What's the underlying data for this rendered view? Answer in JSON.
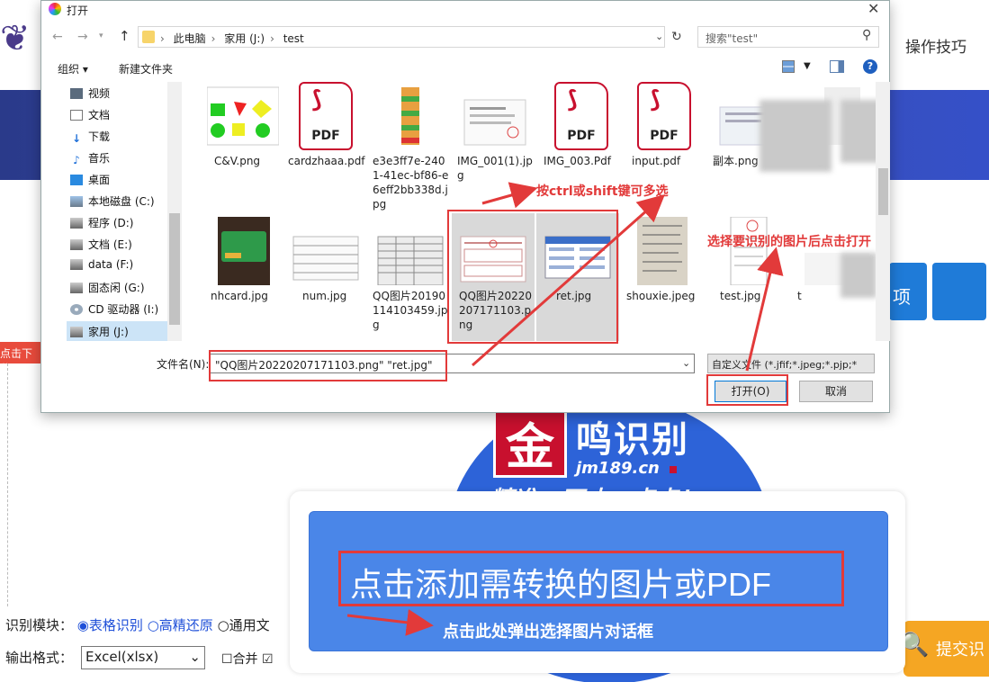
{
  "background": {
    "nav_item": "操作技巧",
    "download_tag": "点击下载",
    "options_label": "识别模块：",
    "options": [
      "表格识别",
      "高精还原",
      "通用文"
    ],
    "format_label": "输出格式：",
    "format_value": "Excel(xlsx)",
    "merge_label": "合并",
    "submit_label": "提交识",
    "tile_text": "项"
  },
  "logo": {
    "mark": "金",
    "name": "鸣识别",
    "url": "jm189.cn",
    "slogan": "精准，不止一点点！"
  },
  "upload": {
    "main_text": "点击添加需转换的图片或PDF",
    "hint": "点击此处弹出选择图片对话框"
  },
  "dialog": {
    "title": "打开",
    "breadcrumb": [
      "此电脑",
      "家用 (J:)",
      "test"
    ],
    "search_placeholder": "搜索\"test\"",
    "toolbar": {
      "organize": "组织 ▾",
      "new_folder": "新建文件夹"
    },
    "nav_items": [
      "视频",
      "文档",
      "下载",
      "音乐",
      "桌面",
      "本地磁盘 (C:)",
      "程序 (D:)",
      "文档 (E:)",
      "data (F:)",
      "固态闲 (G:)",
      "CD 驱动器 (I:)",
      "家用 (J:)"
    ],
    "files_row1": [
      "C&V.png",
      "cardzhaaa.pdf",
      "e3e3ff7e-2401-41ec-bf86-e6eff2bb338d.jpg",
      "IMG_001(1).jpg",
      "IMG_003.Pdf",
      "input.pdf",
      "副本.png",
      "ng"
    ],
    "files_row2": [
      "nhcard.jpg",
      "num.jpg",
      "QQ图片20190114103459.jpg",
      "QQ图片20220207171103.png",
      "ret.jpg",
      "shouxie.jpeg",
      "test.jpg",
      "t"
    ],
    "filename_label": "文件名(N):",
    "filename_value": "\"QQ图片20220207171103.png\" \"ret.jpg\"",
    "filter_value": "自定义文件 (*.jfif;*.jpeg;*.pjp;*",
    "open_label": "打开(O)",
    "cancel_label": "取消"
  },
  "annotations": {
    "multi_select": "按ctrl或shift键可多选",
    "select_then_open": "选择要识别的图片后点击打开"
  },
  "colors": {
    "accent_red": "#e23a3a",
    "upload_blue": "#4a86e8",
    "logo_red": "#c8102e"
  }
}
